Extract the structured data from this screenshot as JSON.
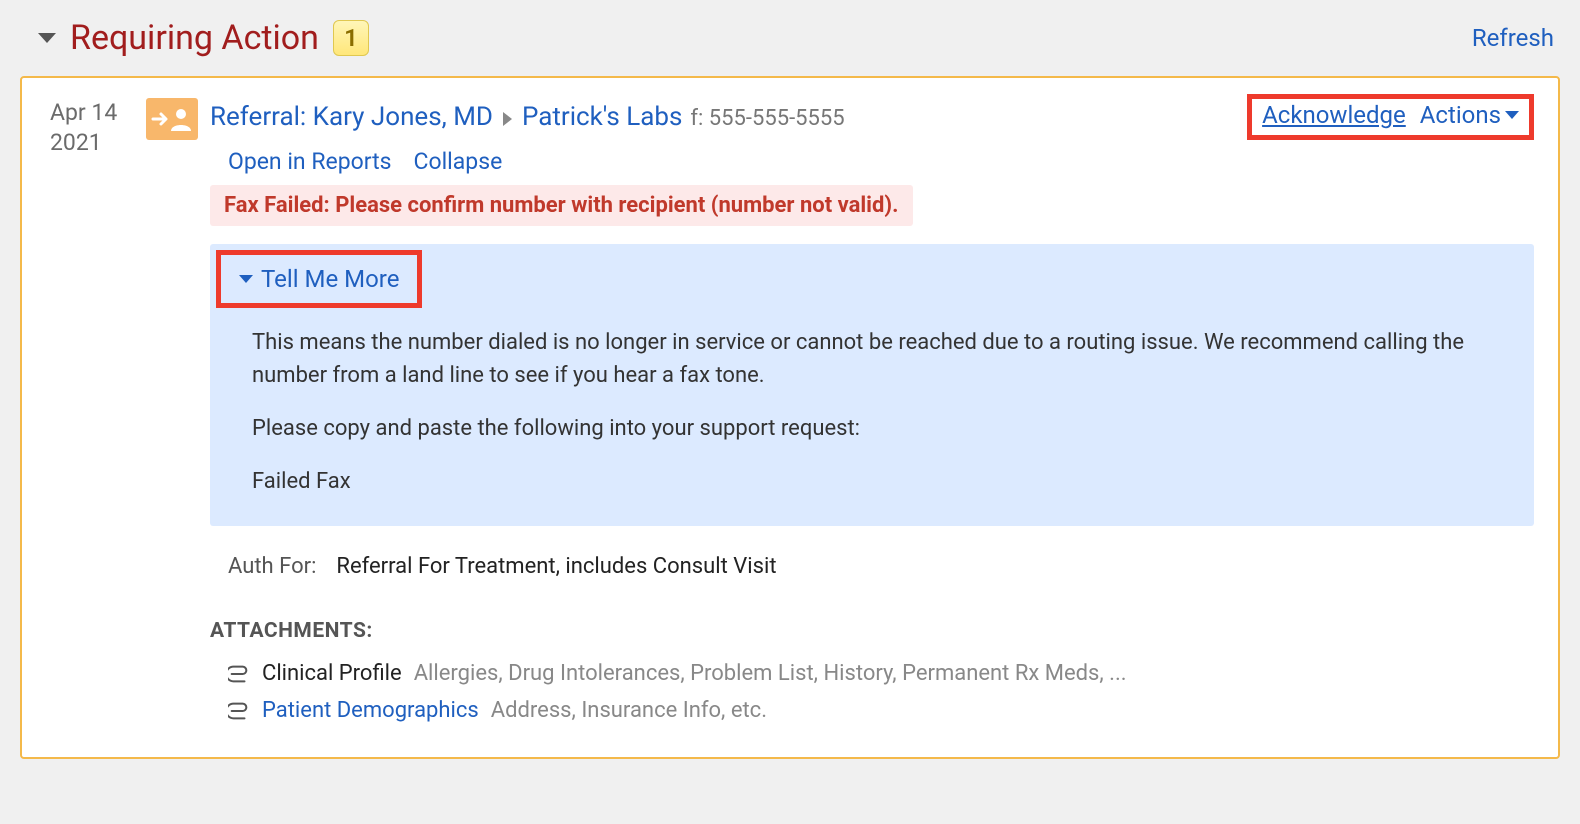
{
  "header": {
    "title": "Requiring Action",
    "count": "1",
    "refresh": "Refresh"
  },
  "item": {
    "date_line1": "Apr 14",
    "date_line2": "2021",
    "referral_prefix": "Referral: ",
    "provider_name": "Kary Jones, MD",
    "destination": "Patrick's Labs",
    "fax_number": "f: 555-555-5555",
    "acknowledge": "Acknowledge",
    "actions": "Actions",
    "open_in_reports": "Open in Reports",
    "collapse": "Collapse",
    "error": "Fax Failed: Please confirm number with recipient (number not valid).",
    "tell_me_more": "Tell Me More",
    "info_p1": "This means the number dialed is no longer in service or cannot be reached due to a routing issue. We recommend calling the number from a land line to see if you hear a fax tone.",
    "info_p2": "Please copy and paste the following into your support request:",
    "info_p3": "Failed Fax",
    "auth_label": "Auth For:",
    "auth_value": "Referral For Treatment, includes Consult Visit",
    "attachments_header": "ATTACHMENTS:",
    "attachments": [
      {
        "title": "Clinical Profile",
        "is_link": false,
        "desc": "Allergies, Drug Intolerances, Problem List, History, Permanent Rx Meds, ..."
      },
      {
        "title": "Patient Demographics",
        "is_link": true,
        "desc": "Address, Insurance Info, etc."
      }
    ]
  }
}
